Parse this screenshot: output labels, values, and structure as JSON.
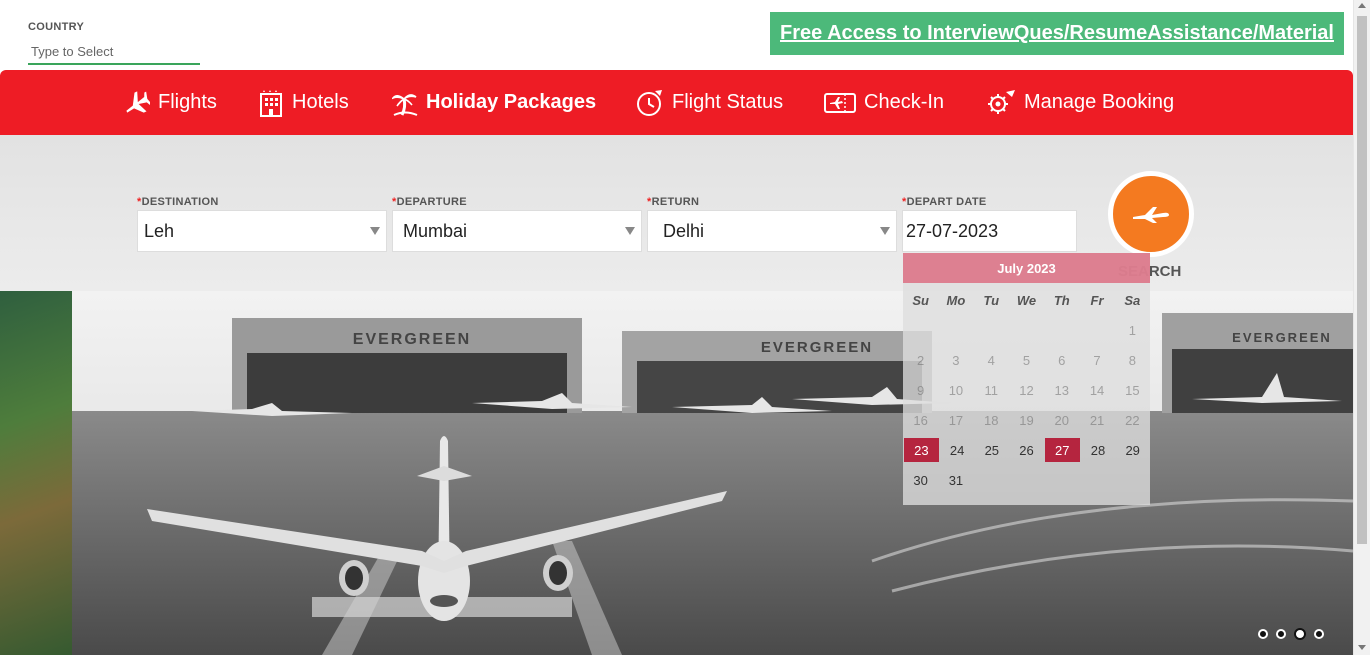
{
  "country": {
    "label": "COUNTRY",
    "placeholder": "Type to Select"
  },
  "promo": {
    "text": "Free Access to InterviewQues/ResumeAssistance/Material"
  },
  "nav": {
    "items": [
      {
        "label": "Flights",
        "icon": "airplane-icon"
      },
      {
        "label": "Hotels",
        "icon": "hotel-icon"
      },
      {
        "label": "Holiday Packages",
        "icon": "palm-tree-icon",
        "active": true
      },
      {
        "label": "Flight Status",
        "icon": "clock-plane-icon"
      },
      {
        "label": "Check-In",
        "icon": "ticket-icon"
      },
      {
        "label": "Manage Booking",
        "icon": "gear-plane-icon"
      }
    ]
  },
  "form": {
    "destination": {
      "label": "DESTINATION",
      "value": "Leh"
    },
    "departure": {
      "label": "DEPARTURE",
      "value": "Mumbai"
    },
    "return": {
      "label": "RETURN",
      "value": "Delhi"
    },
    "depart_date": {
      "label": "DEPART DATE",
      "value": "27-07-2023"
    },
    "required_mark": "*",
    "search_label": "SEARCH"
  },
  "calendar": {
    "month": "July 2023",
    "days_of_week": [
      "Su",
      "Mo",
      "Tu",
      "We",
      "Th",
      "Fr",
      "Sa"
    ],
    "rows": [
      [
        "",
        "",
        "",
        "",
        "",
        "",
        "1"
      ],
      [
        "2",
        "3",
        "4",
        "5",
        "6",
        "7",
        "8"
      ],
      [
        "9",
        "10",
        "11",
        "12",
        "13",
        "14",
        "15"
      ],
      [
        "16",
        "17",
        "18",
        "19",
        "20",
        "21",
        "22"
      ],
      [
        "23",
        "24",
        "25",
        "26",
        "27",
        "28",
        "29"
      ],
      [
        "30",
        "31",
        "",
        "",
        "",
        "",
        ""
      ]
    ],
    "first_enabled_day": 23,
    "highlighted_days": [
      23,
      27
    ]
  },
  "hero": {
    "signs": [
      "EVERGREEN",
      "EVERGREEN",
      "EVERGREEN"
    ],
    "slides": 4,
    "active_slide": 3
  },
  "colors": {
    "nav": "#ee1c25",
    "promo": "#4cb97a",
    "search_button": "#f47a20",
    "calendar_header": "#dc6e82",
    "calendar_selected": "#b5253f"
  }
}
